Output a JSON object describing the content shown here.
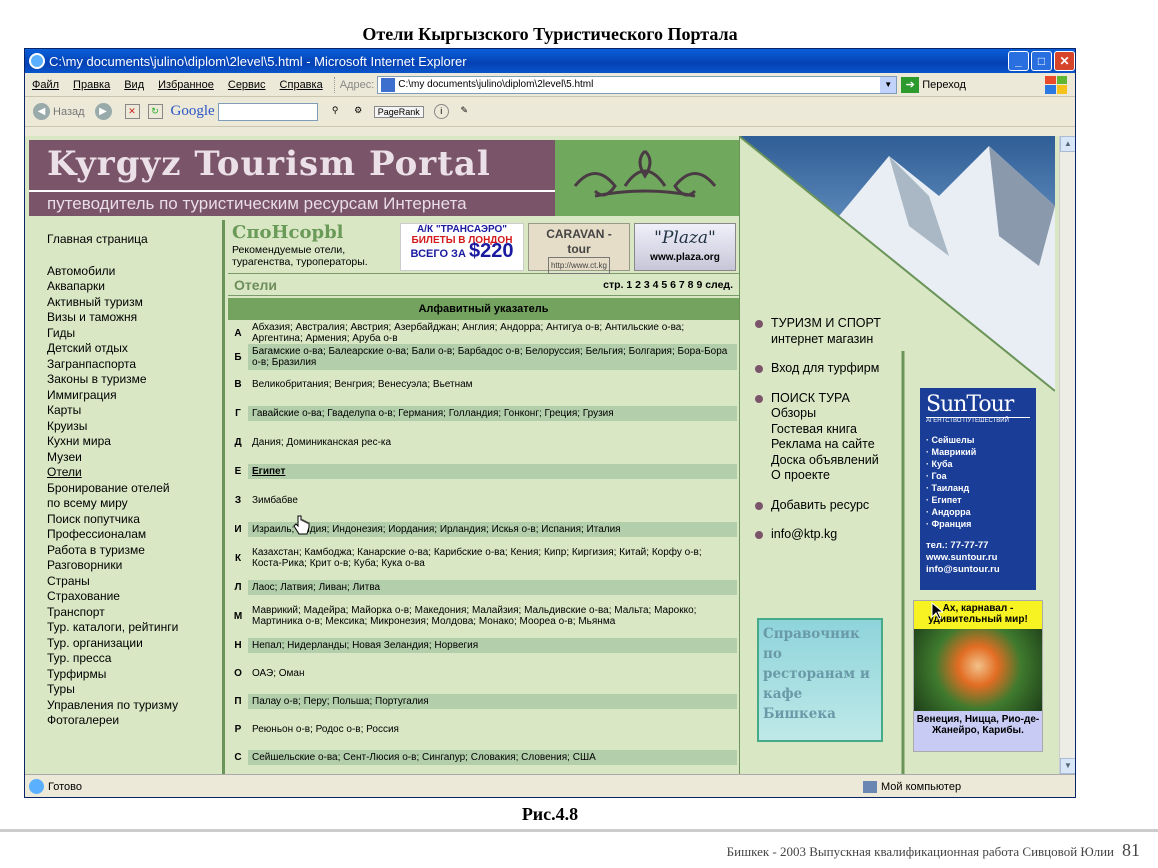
{
  "document": {
    "title": "Отели Кыргызского Туристического Портала",
    "figure_caption": "Рис.4.8",
    "footer_text": "Бишкек - 2003    Выпускная квалификационная работа Сивцовой Юлии",
    "page_number": "81"
  },
  "browser": {
    "window_title": "C:\\my documents\\julino\\diplom\\2level\\5.html - Microsoft Internet Explorer",
    "menu": [
      "Файл",
      "Правка",
      "Вид",
      "Избранное",
      "Сервис",
      "Справка"
    ],
    "address_label": "Адрес:",
    "address": "C:\\my documents\\julino\\diplom\\2level\\5.html",
    "go_label": "Переход",
    "back_label": "Назад",
    "google_label": "Google",
    "pagerank_label": "PageRank",
    "status_text": "Готово",
    "zone_text": "Мой компьютер"
  },
  "site": {
    "banner_title": "Kyrgyz Tourism Portal",
    "banner_subtitle": "путеводитель по туристическим ресурсам Интернета",
    "nav": [
      "Главная страница",
      "",
      "Автомобили",
      "Аквапарки",
      "Активный туризм",
      "Визы и таможня",
      "Гиды",
      "Детский отдых",
      "Загранпаспорта",
      "Законы в туризме",
      "Иммиграция",
      "Карты",
      "Круизы",
      "Кухни мира",
      "Музеи",
      "Отели",
      "Бронирование отелей",
      "по всему миру",
      "Поиск попутчика",
      "Профессионалам",
      "Работа в туризме",
      "Разговорники",
      "Страны",
      "Страхование",
      "Транспорт",
      "Тур. каталоги, рейтинги",
      "Тур. организации",
      "Тур. пресса",
      "Турфирмы",
      "Туры",
      "Управления по туризму",
      "Фотогалереи"
    ],
    "sponsor_logo": "СпоНсорbl",
    "sponsor_text": "Рекомендуемые отели, турагенства, туроператоры.",
    "ads": {
      "transaero_1": "А/К \"ТРАНСАЭРО\"",
      "transaero_2": "БИЛЕТЫ В ЛОНДОН",
      "transaero_3": "ВСЕГО ЗА",
      "transaero_price": "$220",
      "caravan_1": "CARAVAN -",
      "caravan_2": "tour",
      "caravan_url": "http://www.ct.kg",
      "plaza": "\"Plaza\"",
      "plaza_url": "www.plaza.org"
    },
    "section_title": "Отели",
    "pages_text": "стр. 1 2 3 4 5 6 7 8 9 след.",
    "alpha_header": "Алфавитный указатель",
    "index": [
      {
        "letter": "А",
        "text": "Абхазия; Австралия; Австрия; Азербайджан; Англия; Андорра; Антигуа о-в; Антильские о-ва; Аргентина; Армения; Аруба   о-в"
      },
      {
        "letter": "Б",
        "text": "Багамские о-ва; Балеарские о-ва; Бали о-в; Барбадос о-в; Белоруссия;  Бельгия; Болгария; Бора-Бора о-в; Бразилия"
      },
      {
        "letter": "В",
        "text": "Великобритания; Венгрия; Венесуэла; Вьетнам"
      },
      {
        "letter": "Г",
        "text": "Гавайские о-ва; Гваделупа о-в; Германия; Голландия; Гонконг; Греция;  Грузия"
      },
      {
        "letter": "Д",
        "text": "Дания; Доминиканская рес-ка"
      },
      {
        "letter": "Е",
        "text": "Египет"
      },
      {
        "letter": "З",
        "text": "Зимбабве"
      },
      {
        "letter": "И",
        "text": "Израиль; Индия; Индонезия; Иордания; Ирландия; Искья о-в; Испания;  Италия"
      },
      {
        "letter": "К",
        "text": "Казахстан; Камбоджа; Канарские о-ва; Карибские о-ва; Кения; Кипр;  Киргизия; Китай; Корфу о-в; Коста-Рика; Крит о-в; Куба;  Кука о-ва"
      },
      {
        "letter": "Л",
        "text": "Лаос; Латвия; Ливан; Литва"
      },
      {
        "letter": "М",
        "text": "Маврикий; Мадейра; Майорка о-в; Македония; Малайзия; Мальдивские  о-ва; Мальта; Марокко; Мартиника о-в; Мексика; Микронезия;  Молдова; Монако; Моореа о-в; Мьянма"
      },
      {
        "letter": "Н",
        "text": "Непал; Нидерланды; Новая Зеландия; Норвегия"
      },
      {
        "letter": "О",
        "text": "ОАЭ; Оман"
      },
      {
        "letter": "П",
        "text": "Палау о-в; Перу; Польша; Португалия"
      },
      {
        "letter": "Р",
        "text": "Реюньон о-в; Родос о-в; Россия"
      },
      {
        "letter": "С",
        "text": "Сейшельские о-ва; Сент-Люсия о-в; Сингапур; Словакия; Словения;  США"
      }
    ],
    "right_links": {
      "sport_1": "ТУРИЗМ И СПОРТ",
      "sport_2": "интернет магазин",
      "login": "Вход для турфирм",
      "search": "ПОИСК ТУРА",
      "sub": [
        "Обзоры",
        "Гостевая книга",
        "Реклама на сайте",
        "Доска объявлений",
        "О проекте"
      ],
      "add": "Добавить ресурс",
      "email": "info@ktp.kg"
    },
    "restaurant_ad": "Справочник по ресторанам и кафе Бишкека",
    "suntour": {
      "name": "SunTour",
      "tagline": "АГЕНТСТВО ПУТЕШЕСТВИЙ",
      "destinations": [
        "· Сейшелы",
        "· Маврикий",
        "· Куба",
        "· Гоа",
        "· Таиланд",
        "· Египет",
        "· Андорра",
        "· Франция"
      ],
      "phone": "тел.: 77-77-77",
      "site": "www.suntour.ru",
      "email": "info@suntour.ru"
    },
    "carnival": {
      "top": "Ах, карнавал - удивительный мир!",
      "bottom": "Венеция, Ницца, Рио-де-Жанейро, Карибы."
    }
  }
}
